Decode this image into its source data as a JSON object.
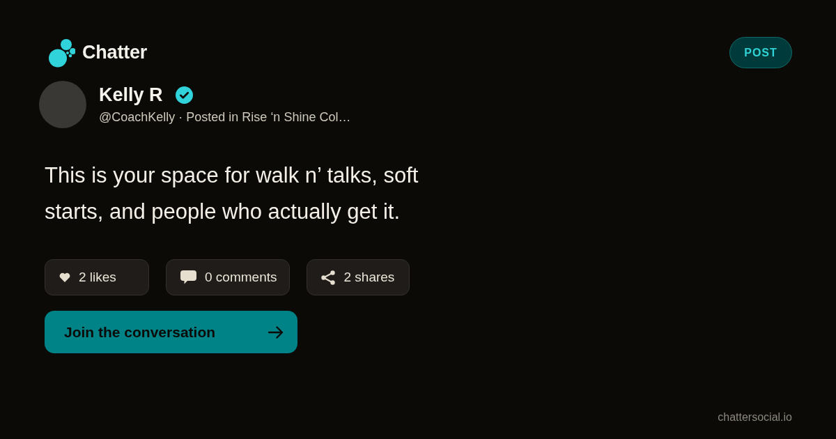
{
  "brand": {
    "name": "Chatter"
  },
  "badge": {
    "label": "POST"
  },
  "author": {
    "name": "Kelly R",
    "verified": true,
    "subtitle": "@CoachKelly · Posted in Rise ‘n Shine Col…"
  },
  "post": {
    "text": "This is your space for walk n’ talks, soft starts, and people who actually get it."
  },
  "stats": [
    {
      "kind": "likes",
      "label": "2 likes"
    },
    {
      "kind": "comments",
      "label": "0 comments"
    },
    {
      "kind": "shares",
      "label": "2 shares"
    }
  ],
  "cta": {
    "label": "Join the conversation"
  },
  "footer": {
    "domain": "chattersocial.io"
  }
}
